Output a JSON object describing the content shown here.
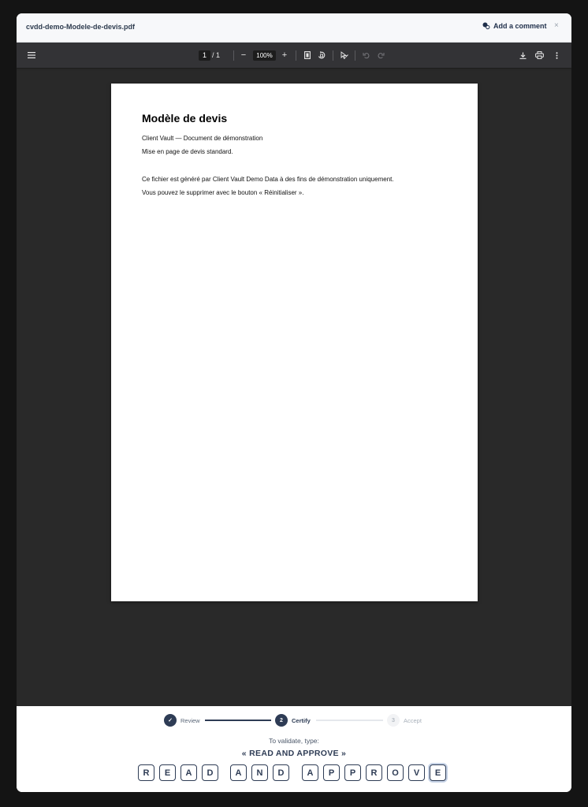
{
  "modal": {
    "file_name": "cvdd-demo-Modele-de-devis.pdf",
    "comment_label": "Add a comment",
    "close_symbol": "×"
  },
  "toolbar": {
    "page_current": "1",
    "page_total": "/  1",
    "zoom": "100%",
    "minus": "−",
    "plus": "+"
  },
  "document": {
    "heading": "Modèle de devis",
    "lines": [
      "Client Vault — Document de démonstration",
      "Mise en page de devis standard.",
      "Ce fichier est généré par Client Vault Demo Data à des fins de démonstration uniquement.",
      "Vous pouvez le supprimer avec le bouton « Réinitialiser »."
    ]
  },
  "steps": [
    {
      "number": "✓",
      "label": "Review",
      "state": "done"
    },
    {
      "number": "2",
      "label": "Certify",
      "state": "active"
    },
    {
      "number": "3",
      "label": "Accept",
      "state": "pending"
    }
  ],
  "certify": {
    "instruction": "To validate, type:",
    "phrase": "« READ AND APPROVE »",
    "letters": [
      "R",
      "E",
      "A",
      "D",
      "A",
      "N",
      "D",
      "A",
      "P",
      "P",
      "R",
      "O",
      "V",
      "E"
    ]
  },
  "colors": {
    "accent": "#2e3c55",
    "viewer_bg": "#292929",
    "toolbar_bg": "#333336"
  }
}
